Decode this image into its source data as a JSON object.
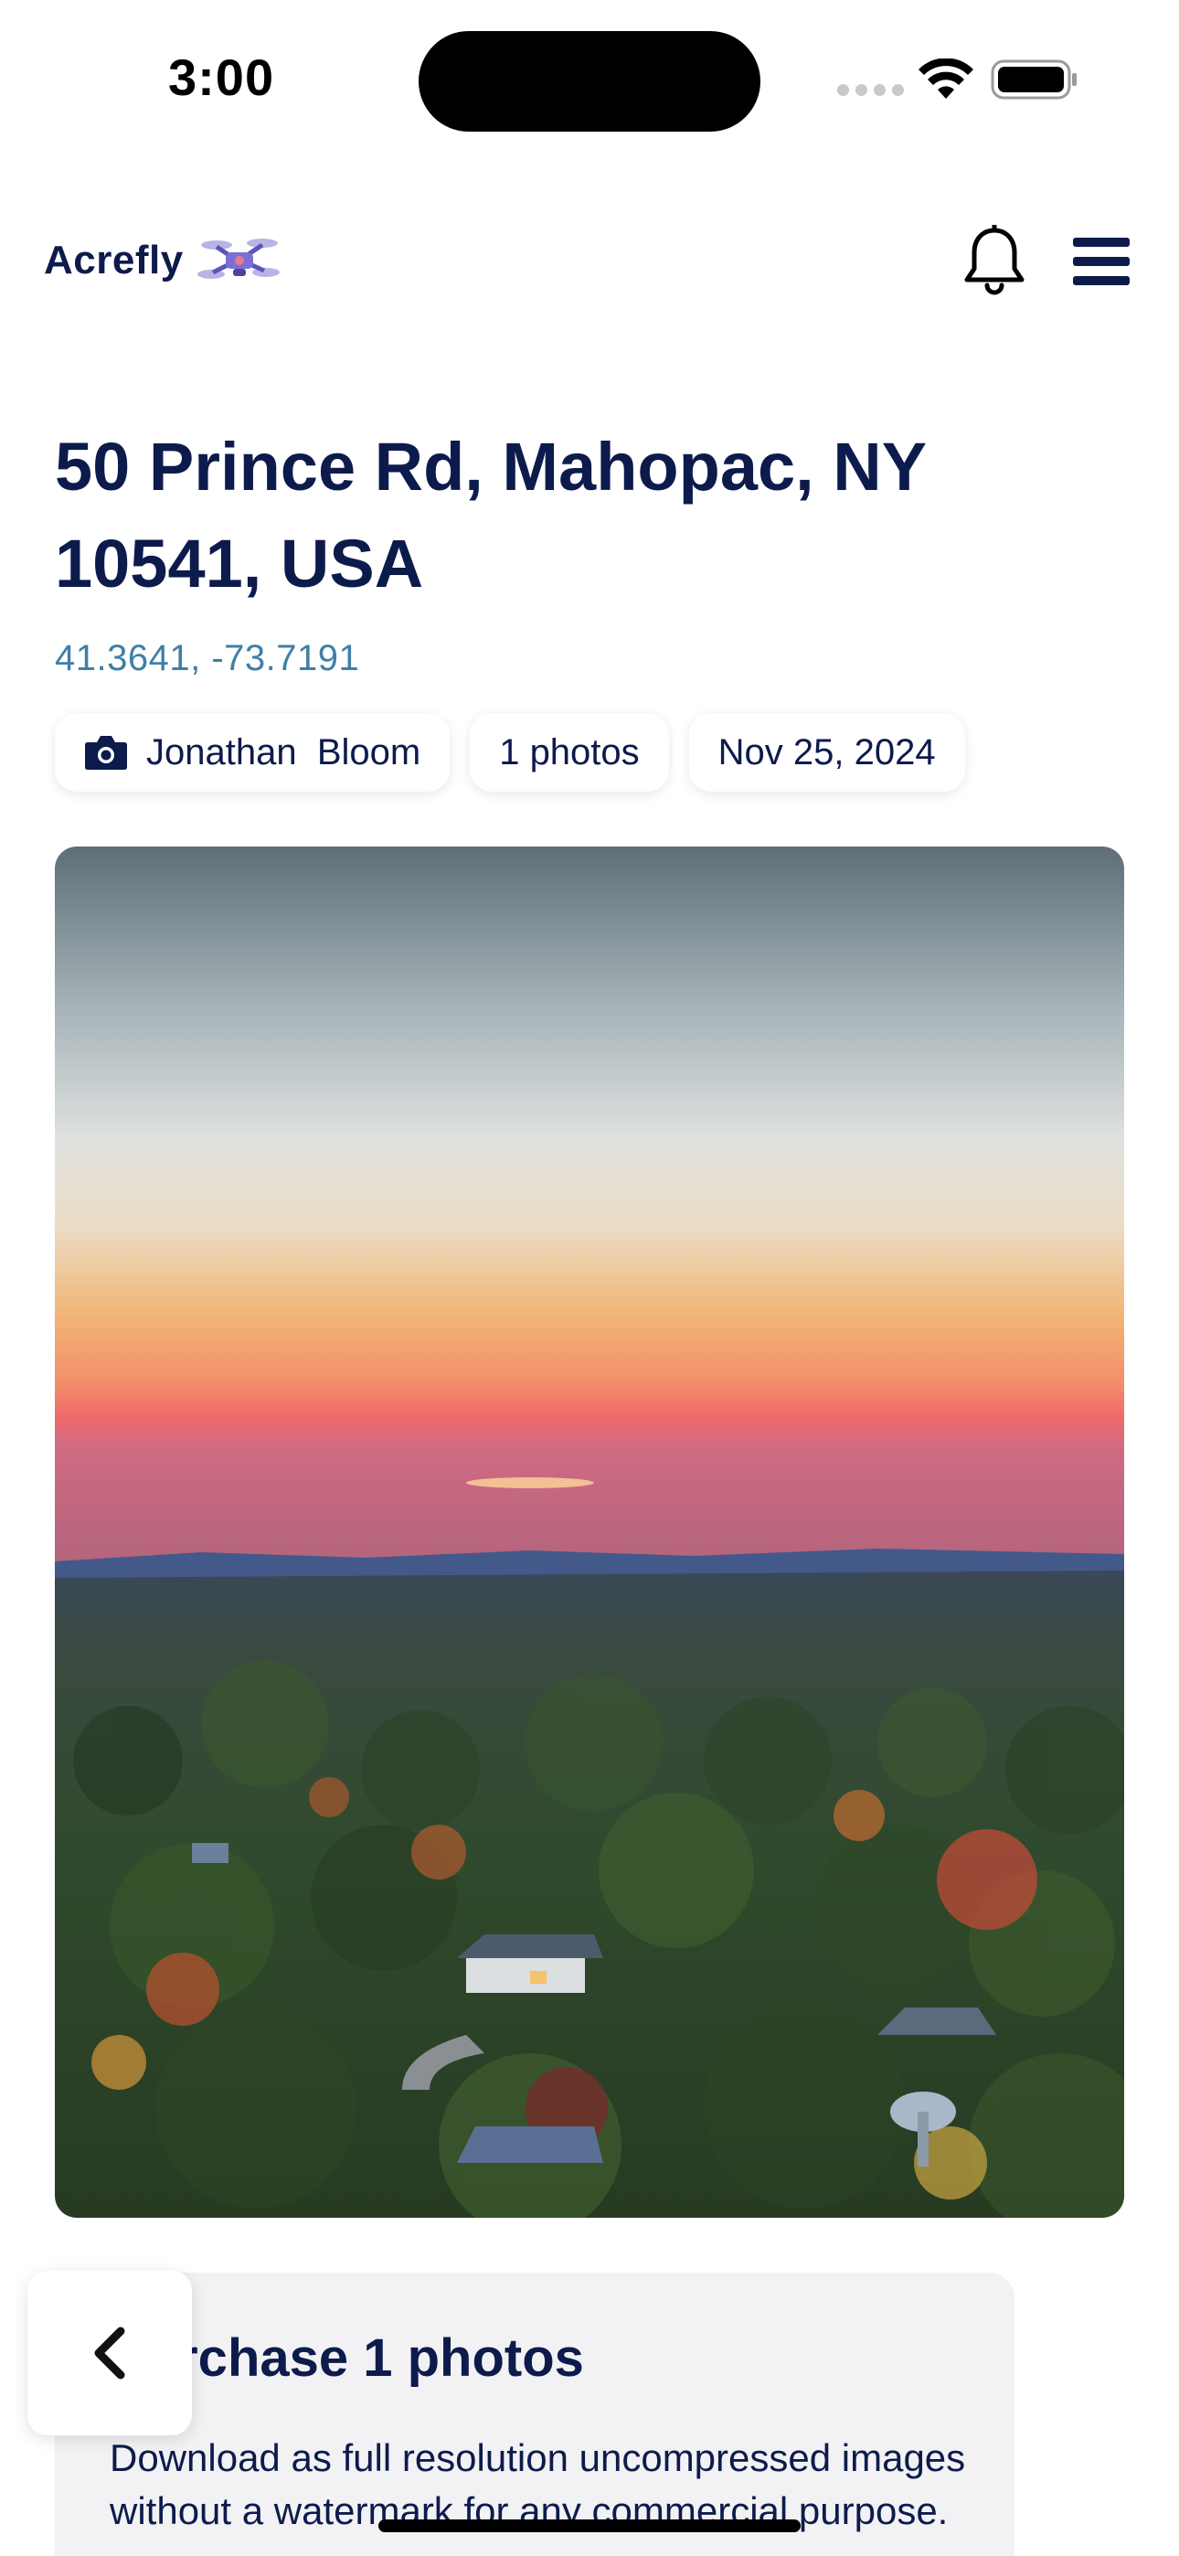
{
  "status_bar": {
    "time": "3:00"
  },
  "header": {
    "brand_name": "Acrefly",
    "icons": [
      "drone-icon",
      "bell-icon",
      "menu-icon"
    ]
  },
  "listing": {
    "address": "50 Prince Rd, Mahopac, NY 10541, USA",
    "coordinates": "41.3641, -73.7191",
    "photographer": "Jonathan  Bloom",
    "photo_count": "1 photos",
    "date": "Nov 25, 2024"
  },
  "purchase": {
    "title": "Purchase 1 photos",
    "description": "Download as full resolution uncompressed images without a watermark for any commercial purpose."
  },
  "colors": {
    "navy": "#0d1b4c",
    "coords_blue": "#3f7fa6",
    "card_bg": "#f2f2f4"
  }
}
